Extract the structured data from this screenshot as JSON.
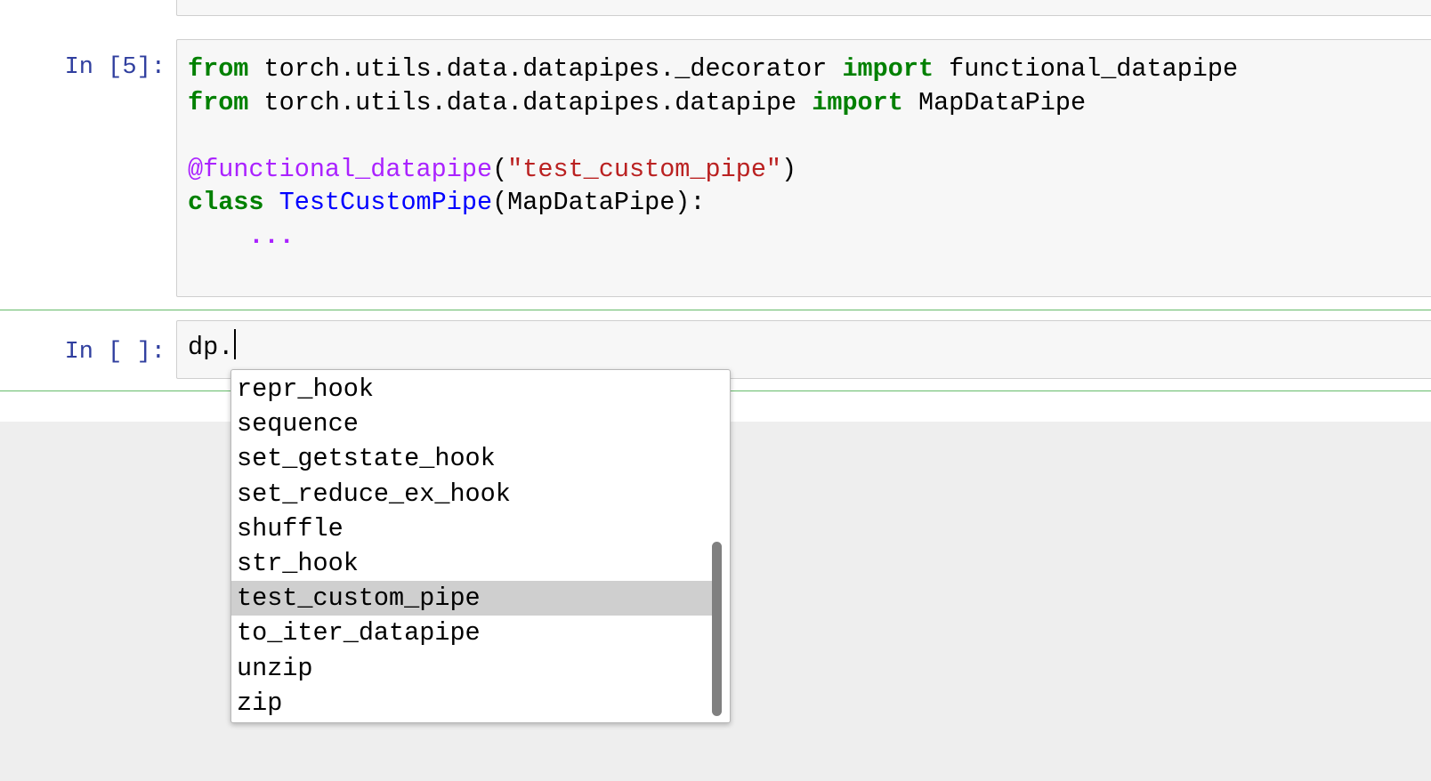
{
  "cells": [
    {
      "prompt": "In [5]:",
      "code_lines": [
        [
          {
            "t": "from",
            "c": "kw"
          },
          {
            "t": " torch.utils.data.datapipes._decorator ",
            "c": ""
          },
          {
            "t": "import",
            "c": "kw"
          },
          {
            "t": " functional_datapipe",
            "c": ""
          }
        ],
        [
          {
            "t": "from",
            "c": "kw"
          },
          {
            "t": " torch.utils.data.datapipes.datapipe ",
            "c": ""
          },
          {
            "t": "import",
            "c": "kw"
          },
          {
            "t": " MapDataPipe",
            "c": ""
          }
        ],
        [],
        [
          {
            "t": "@functional_datapipe",
            "c": "dec"
          },
          {
            "t": "(",
            "c": ""
          },
          {
            "t": "\"test_custom_pipe\"",
            "c": "str"
          },
          {
            "t": ")",
            "c": ""
          }
        ],
        [
          {
            "t": "class",
            "c": "kw"
          },
          {
            "t": " ",
            "c": ""
          },
          {
            "t": "TestCustomPipe",
            "c": "cls"
          },
          {
            "t": "(MapDataPipe):",
            "c": ""
          }
        ],
        [
          {
            "t": "    ",
            "c": ""
          },
          {
            "t": "...",
            "c": "ell"
          }
        ]
      ]
    },
    {
      "prompt": "In [ ]:",
      "input_value": "dp."
    }
  ],
  "autocomplete": {
    "items": [
      "repr_hook",
      "sequence",
      "set_getstate_hook",
      "set_reduce_ex_hook",
      "shuffle",
      "str_hook",
      "test_custom_pipe",
      "to_iter_datapipe",
      "unzip",
      "zip"
    ],
    "selected": "test_custom_pipe",
    "scroll_position": 0.97
  }
}
